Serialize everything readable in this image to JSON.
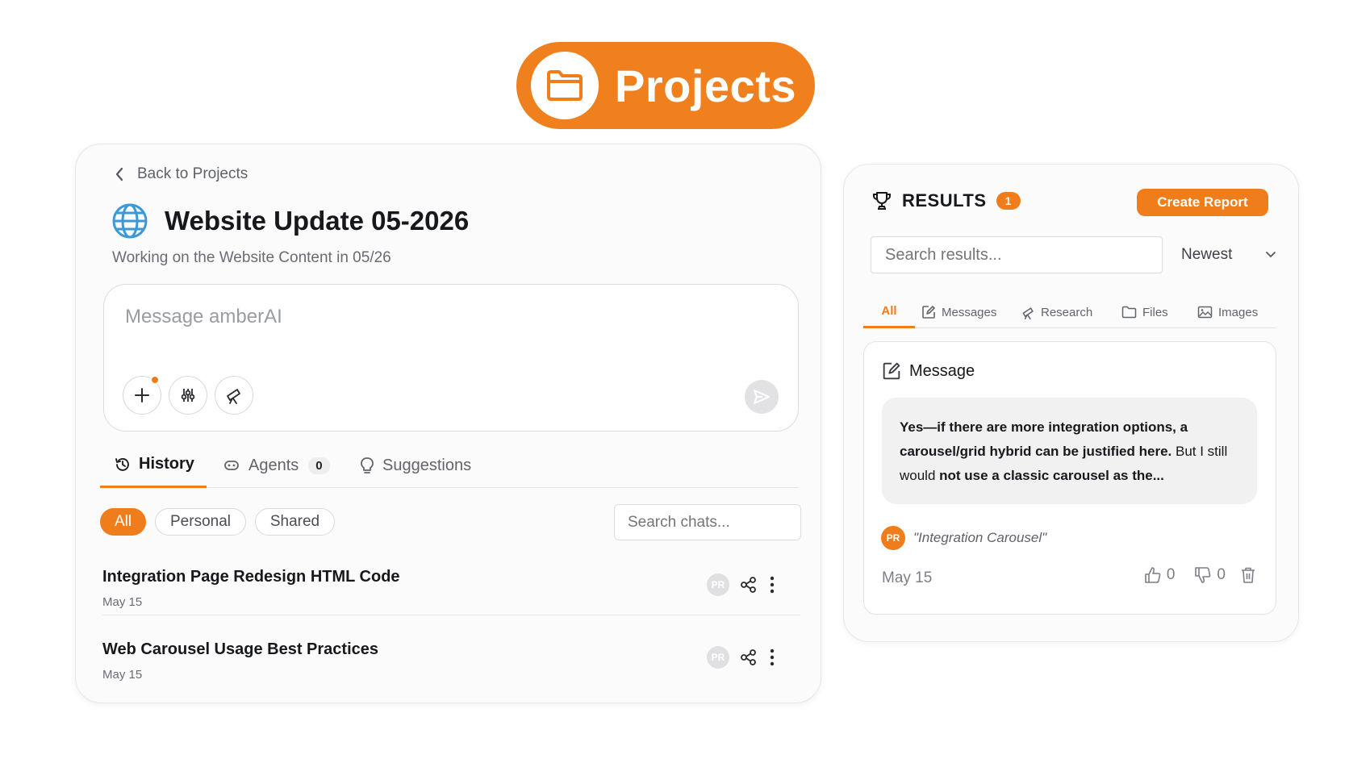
{
  "hero": {
    "title": "Projects"
  },
  "project": {
    "back_label": "Back to Projects",
    "title": "Website Update 05-2026",
    "subtitle": "Working on the Website Content in 05/26"
  },
  "composer": {
    "placeholder": "Message amberAI"
  },
  "tabs": {
    "history": "History",
    "agents": "Agents",
    "agents_count": "0",
    "suggestions": "Suggestions"
  },
  "filters": {
    "all": "All",
    "personal": "Personal",
    "shared": "Shared"
  },
  "chat_search": {
    "placeholder": "Search chats..."
  },
  "chats": [
    {
      "title": "Integration Page Redesign HTML Code",
      "date": "May 15",
      "avatar": "PR"
    },
    {
      "title": "Web Carousel Usage Best Practices",
      "date": "May 15",
      "avatar": "PR"
    }
  ],
  "results": {
    "label": "RESULTS",
    "count": "1",
    "create_label": "Create Report",
    "search_placeholder": "Search results...",
    "sort_label": "Newest",
    "tabs": {
      "all": "All",
      "messages": "Messages",
      "research": "Research",
      "files": "Files",
      "images": "Images"
    },
    "card": {
      "label": "Message",
      "text_1": "Yes—if there are more integration options, a carousel/grid hybrid can be justified here.",
      "text_2": " But I still would ",
      "text_3": "not use a classic carousel as the...",
      "avatar": "PR",
      "quote": "\"Integration Carousel\"",
      "date": "May 15",
      "likes": "0",
      "dislikes": "0"
    }
  },
  "colors": {
    "accent": "#f07d1c",
    "text": "#17181c",
    "muted": "#6a6c73"
  }
}
